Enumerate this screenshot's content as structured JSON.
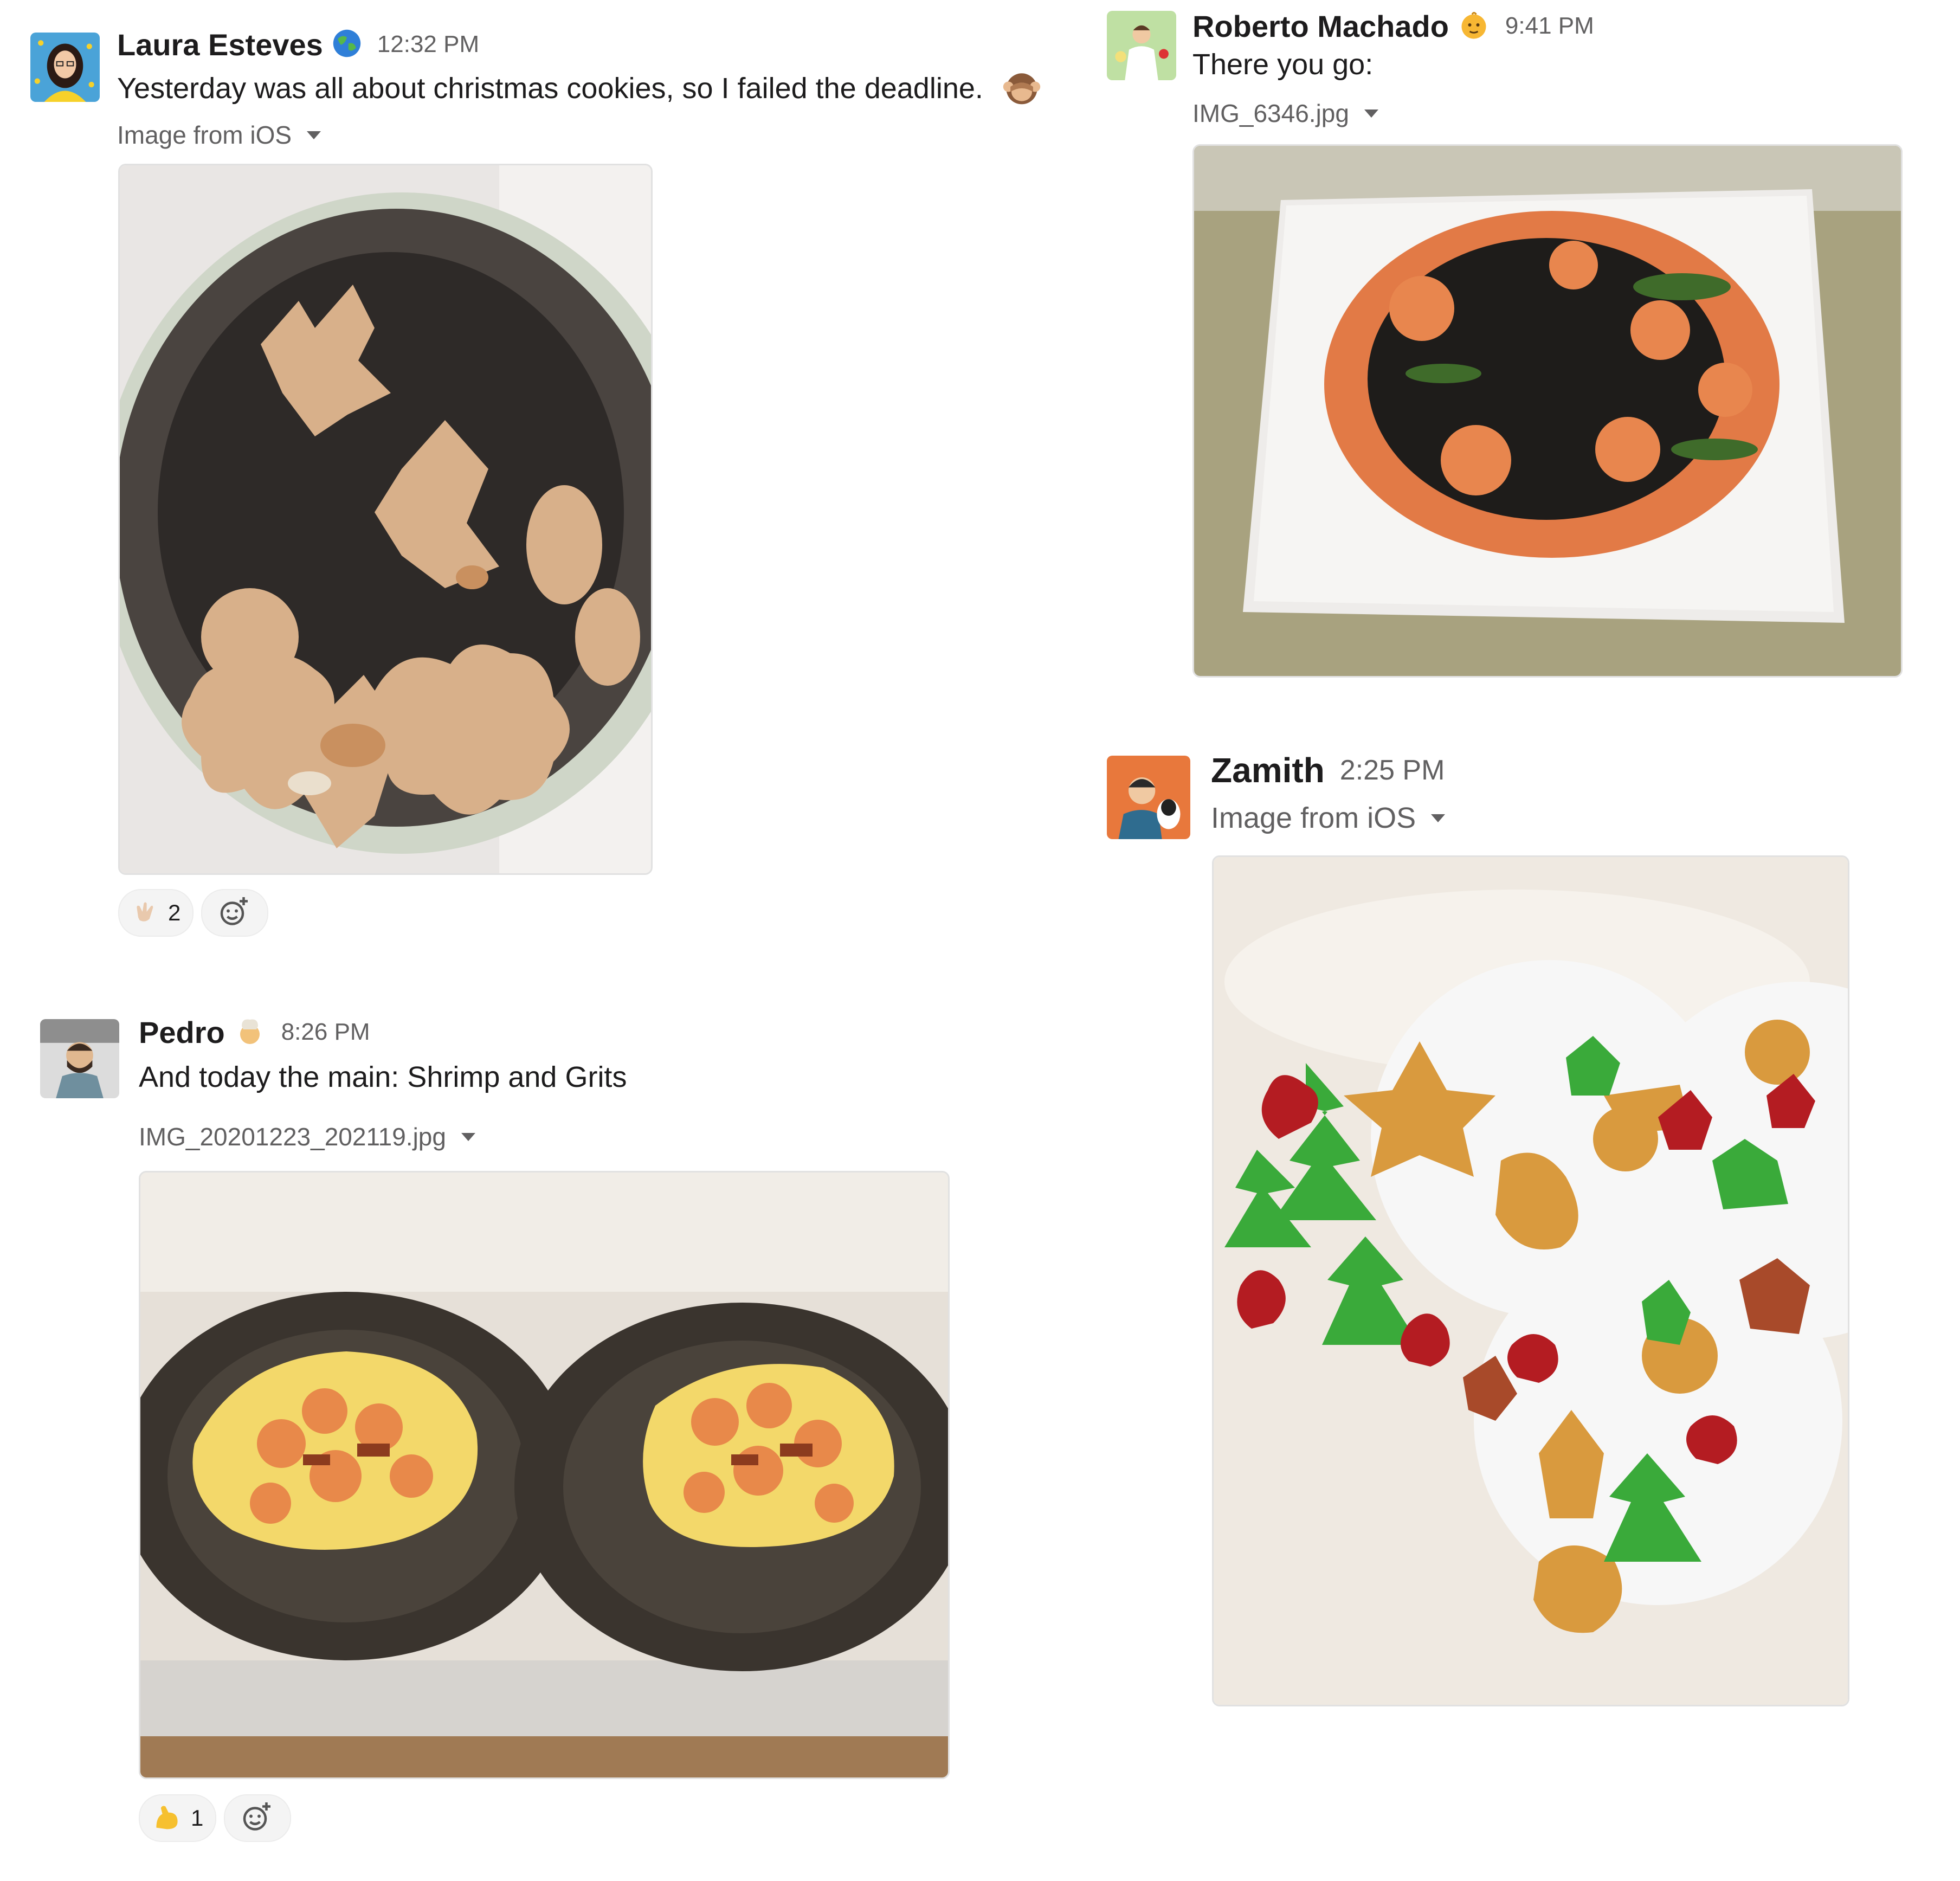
{
  "messages": [
    {
      "author": "Laura Esteves",
      "status_emoji": "globe-icon",
      "time": "12:32 PM",
      "text": "Yesterday was all about christmas cookies, so I failed the deadline.",
      "text_emoji": "see-no-evil-monkey-icon",
      "file_name": "Image from iOS",
      "image": "christmas-cookies-in-tin",
      "reactions": [
        {
          "emoji": "clapping-hands-icon",
          "count": "2"
        }
      ]
    },
    {
      "author": "Roberto Machado",
      "status_emoji": "baby-icon",
      "time": "9:41 PM",
      "text": "There you go:",
      "file_name": "IMG_6346.jpg",
      "image": "black-pasta-with-salmon"
    },
    {
      "author": "Pedro",
      "status_emoji": "chef-icon",
      "time": "8:26 PM",
      "text": "And today the main: Shrimp and Grits",
      "file_name": "IMG_20201223_202119.jpg",
      "image": "shrimp-and-grits-plates",
      "reactions": [
        {
          "emoji": "flexed-biceps-icon",
          "count": "1"
        }
      ]
    },
    {
      "author": "Zamith",
      "time": "2:25 PM",
      "file_name": "Image from iOS",
      "image": "decorated-gingerbread-cookies"
    }
  ],
  "colors": {
    "name": "#1d1c1d",
    "meta": "#616061",
    "reaction_bg": "#f4f4f4",
    "zamith_avatar_bg": "#e8783c"
  }
}
